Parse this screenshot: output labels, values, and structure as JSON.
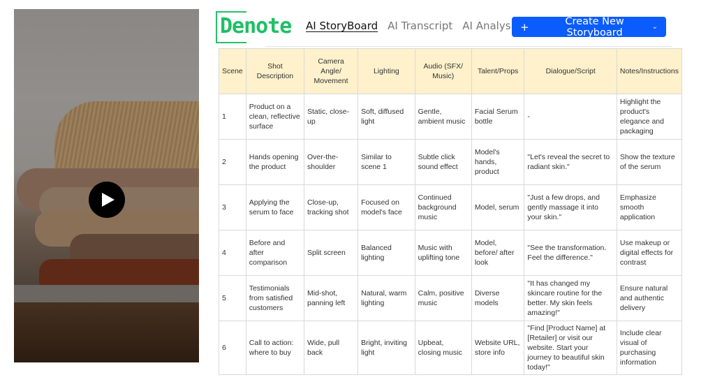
{
  "logo": {
    "text": "Denote",
    "color": "#1fbf66"
  },
  "nav": {
    "tabs": [
      {
        "label": "AI StoryBoard",
        "active": true
      },
      {
        "label": "AI Transcript",
        "active": false
      },
      {
        "label": "AI Analysis",
        "active": false
      }
    ]
  },
  "create_button": {
    "icon": "plus-icon",
    "label": "Create New Storyboard",
    "dropdown_icon": "chevron-down-icon",
    "color": "#0b5cff"
  },
  "video": {
    "play_icon": "play-icon",
    "subject": "stack of folded knit sweaters"
  },
  "table": {
    "header_bg": "#fef1cc",
    "columns": [
      "Scene",
      "Shot Description",
      "Camera Angle/ Movement",
      "Lighting",
      "Audio (SFX/ Music)",
      "Talent/Props",
      "Dialogue/Script",
      "Notes/Instructions"
    ],
    "rows": [
      [
        "1",
        "Product on a clean, reflective surface",
        "Static, close-up",
        "Soft, diffused light",
        "Gentle, ambient music",
        "Facial Serum bottle",
        "-",
        "Highlight the product's elegance and packaging"
      ],
      [
        "2",
        "Hands opening the product",
        "Over-the-shoulder",
        "Similar to scene 1",
        "Subtle click sound effect",
        "Model's hands, product",
        "\"Let's reveal the secret to radiant skin.\"",
        "Show the texture of the serum"
      ],
      [
        "3",
        "Applying the serum to face",
        "Close-up, tracking shot",
        "Focused on model's face",
        "Continued background music",
        "Model, serum",
        "\"Just a few drops, and gently massage it into your skin.\"",
        "Emphasize smooth application"
      ],
      [
        "4",
        "Before and after comparison",
        "Split screen",
        "Balanced lighting",
        "Music with uplifting tone",
        "Model, before/ after look",
        "\"See the transformation. Feel the difference.\"",
        "Use makeup or digital effects for contrast"
      ],
      [
        "5",
        "Testimonials from satisfied customers",
        "Mid-shot, panning left",
        "Natural, warm lighting",
        "Calm, positive music",
        "Diverse models",
        "\"It has changed my skincare routine for the better. My skin feels amazing!\"",
        "Ensure natural and authentic delivery"
      ],
      [
        "6",
        "Call to action: where to buy",
        "Wide, pull back",
        "Bright, inviting light",
        "Upbeat, closing music",
        "Website URL, store info",
        "\"Find [Product Name] at [Retailer] or visit our website. Start your journey to beautiful skin today!\"",
        "Include clear visual of purchasing information"
      ]
    ]
  }
}
